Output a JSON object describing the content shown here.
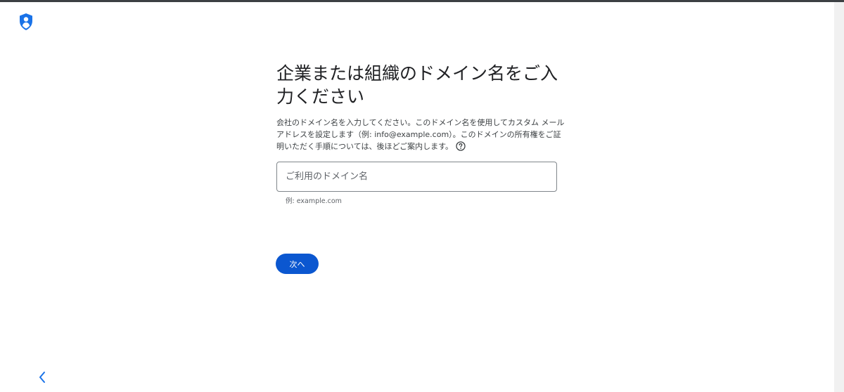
{
  "header": {
    "logo_icon": "shield-person-icon"
  },
  "main": {
    "title": "企業または組織のドメイン名をご入力ください",
    "description": "会社のドメイン名を入力してください。このドメイン名を使用してカスタム メールアドレスを設定します（例: info@example.com）。このドメインの所有権をご証明いただく手順については、後ほどご案内します。",
    "help_icon": "help-circle-icon",
    "domain_input": {
      "placeholder": "ご利用のドメイン名",
      "value": ""
    },
    "hint": "例: example.com",
    "next_label": "次へ"
  },
  "nav": {
    "back_icon": "chevron-left-icon"
  },
  "colors": {
    "primary": "#0b57d0",
    "logo": "#1a73e8",
    "text": "#202124",
    "muted": "#5f6368"
  }
}
